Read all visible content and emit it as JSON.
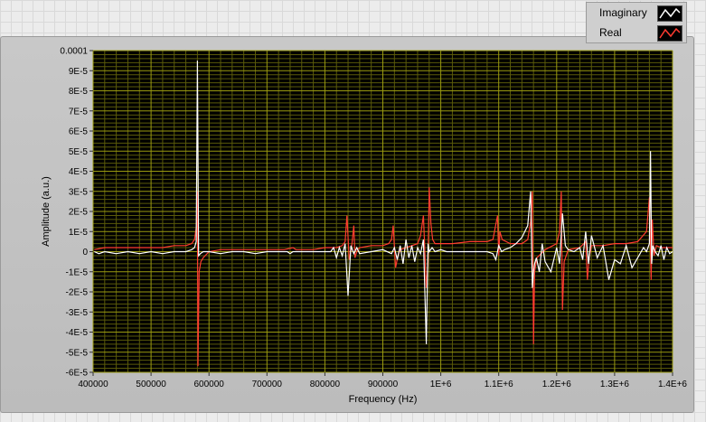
{
  "legend": {
    "items": [
      {
        "label": "Imaginary",
        "color": "#ffffff",
        "icon": "white-line-swatch"
      },
      {
        "label": "Real",
        "color": "#ff3b30",
        "icon": "red-line-swatch"
      }
    ]
  },
  "colors": {
    "plot_background": "#000000",
    "grid_major": "#9a9a10",
    "grid_minor": "#5a5a0a",
    "imaginary": "#ffffff",
    "real": "#ff3b30"
  },
  "chart_data": {
    "type": "line",
    "xlabel": "Frequency (Hz)",
    "ylabel": "Amplitude (a.u.)",
    "xlim": [
      400000,
      1400000
    ],
    "ylim": [
      -6e-05,
      0.0001
    ],
    "x_ticks": [
      400000,
      500000,
      600000,
      700000,
      800000,
      900000,
      1000000,
      1100000,
      1200000,
      1300000,
      1400000
    ],
    "x_tick_labels": [
      "400000",
      "500000",
      "600000",
      "700000",
      "800000",
      "900000",
      "1E+6",
      "1.1E+6",
      "1.2E+6",
      "1.3E+6",
      "1.4E+6"
    ],
    "y_ticks": [
      -6e-05,
      -5e-05,
      -4e-05,
      -3e-05,
      -2e-05,
      -1e-05,
      0,
      1e-05,
      2e-05,
      3e-05,
      4e-05,
      5e-05,
      6e-05,
      7e-05,
      8e-05,
      9e-05,
      0.0001
    ],
    "y_tick_labels": [
      "-6E-5",
      "-5E-5",
      "-4E-5",
      "-3E-5",
      "-2E-5",
      "-1E-5",
      "0",
      "1E-5",
      "2E-5",
      "3E-5",
      "4E-5",
      "5E-5",
      "6E-5",
      "7E-5",
      "8E-5",
      "9E-5",
      "0.0001"
    ],
    "grid": true,
    "legend_position": "top-right",
    "series": [
      {
        "name": "Imaginary",
        "color": "#ffffff",
        "x": [
          402000,
          410000,
          420000,
          440000,
          460000,
          480000,
          500000,
          520000,
          540000,
          560000,
          570000,
          575000,
          578000,
          580000,
          582000,
          585000,
          590000,
          600000,
          620000,
          640000,
          660000,
          680000,
          700000,
          720000,
          735000,
          740000,
          745000,
          750000,
          770000,
          790000,
          800000,
          810000,
          815000,
          820000,
          825000,
          830000,
          835000,
          840000,
          845000,
          850000,
          855000,
          860000,
          880000,
          900000,
          915000,
          920000,
          925000,
          930000,
          935000,
          940000,
          945000,
          950000,
          955000,
          960000,
          965000,
          970000,
          975000,
          978000,
          980000,
          985000,
          990000,
          1000000,
          1010000,
          1020000,
          1040000,
          1060000,
          1080000,
          1090000,
          1095000,
          1100000,
          1105000,
          1110000,
          1120000,
          1130000,
          1140000,
          1150000,
          1155000,
          1158000,
          1160000,
          1162000,
          1165000,
          1170000,
          1175000,
          1180000,
          1190000,
          1200000,
          1205000,
          1210000,
          1215000,
          1220000,
          1230000,
          1240000,
          1245000,
          1250000,
          1255000,
          1260000,
          1270000,
          1280000,
          1290000,
          1300000,
          1310000,
          1320000,
          1330000,
          1340000,
          1350000,
          1355000,
          1360000,
          1362000,
          1364000,
          1366000,
          1370000,
          1375000,
          1380000,
          1385000,
          1390000,
          1395000,
          1400000
        ],
        "y": [
          0,
          -1e-06,
          0,
          -1e-06,
          0,
          -1e-06,
          0,
          -1e-06,
          0,
          0,
          1e-06,
          2e-06,
          5e-06,
          9.5e-05,
          -2e-06,
          -1e-06,
          0,
          0,
          -1e-06,
          0,
          0,
          -1e-06,
          0,
          0,
          0,
          -1e-06,
          0,
          0,
          0,
          0,
          0,
          0,
          2e-06,
          -3e-06,
          2e-06,
          -2e-06,
          4e-06,
          -2.2e-05,
          3e-06,
          -1e-06,
          2e-06,
          -1e-06,
          0,
          1e-06,
          -1e-06,
          2e-06,
          -4e-06,
          3e-06,
          -6e-06,
          6e-06,
          -3e-06,
          3e-06,
          -5e-06,
          2e-06,
          -1e-06,
          6e-06,
          -4.6e-05,
          4e-06,
          0,
          2e-06,
          0,
          1e-06,
          0,
          0,
          0,
          0,
          0,
          -1e-06,
          -4e-06,
          3e-06,
          0,
          1e-06,
          2e-06,
          4e-06,
          7e-06,
          1.3e-05,
          3e-05,
          -1.8e-05,
          -1e-05,
          -6e-06,
          -3e-06,
          -1e-05,
          4e-06,
          -5e-06,
          -1e-05,
          2e-06,
          -6e-06,
          1.9e-05,
          3e-06,
          1e-06,
          0,
          2e-06,
          -4e-06,
          1e-05,
          -6e-06,
          8e-06,
          -3e-06,
          3e-06,
          -1.4e-05,
          -4e-06,
          -6e-06,
          3e-06,
          -8e-06,
          -3e-06,
          2e-06,
          0,
          4e-06,
          5e-05,
          -6e-06,
          3e-06,
          0,
          -2e-06,
          3e-06,
          -4e-06,
          2e-06,
          -1e-06,
          0
        ]
      },
      {
        "name": "Real",
        "color": "#ff3b30",
        "x": [
          402000,
          420000,
          440000,
          460000,
          480000,
          500000,
          520000,
          540000,
          560000,
          570000,
          575000,
          578000,
          580000,
          581000,
          583000,
          586000,
          590000,
          600000,
          620000,
          650000,
          700000,
          730000,
          745000,
          750000,
          780000,
          800000,
          820000,
          830000,
          835000,
          838000,
          842000,
          846000,
          850000,
          852000,
          856000,
          860000,
          880000,
          900000,
          910000,
          915000,
          918000,
          922000,
          926000,
          930000,
          940000,
          950000,
          960000,
          965000,
          970000,
          975000,
          978000,
          980000,
          983000,
          986000,
          990000,
          1000000,
          1020000,
          1050000,
          1080000,
          1090000,
          1098000,
          1100000,
          1102000,
          1106000,
          1120000,
          1140000,
          1150000,
          1155000,
          1158000,
          1160000,
          1162000,
          1166000,
          1180000,
          1200000,
          1205000,
          1208000,
          1210000,
          1213000,
          1220000,
          1240000,
          1250000,
          1253000,
          1256000,
          1260000,
          1280000,
          1300000,
          1320000,
          1340000,
          1355000,
          1360000,
          1363000,
          1365000,
          1368000,
          1372000,
          1380000,
          1390000,
          1400000
        ],
        "y": [
          1e-06,
          2e-06,
          2e-06,
          2e-06,
          2e-06,
          2e-06,
          2e-06,
          3e-06,
          3e-06,
          4e-06,
          6e-06,
          1.2e-05,
          3e-05,
          -5.7e-05,
          -1e-05,
          -5e-06,
          -3e-06,
          0,
          1e-06,
          1e-06,
          1e-06,
          1e-06,
          2e-06,
          1e-06,
          1e-06,
          2e-06,
          2e-06,
          3e-06,
          5e-06,
          1.8e-05,
          -4e-06,
          2e-06,
          1.3e-05,
          -3e-06,
          1e-06,
          2e-06,
          3e-06,
          3e-06,
          4e-06,
          6e-06,
          1.3e-05,
          -8e-06,
          -2e-06,
          1e-06,
          2e-06,
          3e-06,
          4e-06,
          8e-06,
          1.8e-05,
          -1.8e-05,
          -5e-06,
          3.2e-05,
          1.4e-05,
          6e-06,
          4e-06,
          4e-06,
          4e-06,
          5e-06,
          5e-06,
          6e-06,
          1.8e-05,
          -2e-06,
          1e-05,
          6e-06,
          4e-06,
          4e-06,
          6e-06,
          1.5e-05,
          3e-05,
          -4.6e-05,
          -1e-05,
          -3e-06,
          1e-06,
          4e-06,
          1e-05,
          3e-05,
          -2.9e-05,
          -5e-06,
          1e-06,
          2e-06,
          5e-06,
          -1.4e-05,
          -3e-06,
          3e-06,
          3e-06,
          4e-06,
          4e-06,
          5e-06,
          1e-05,
          2.7e-05,
          -1.4e-05,
          1.6e-05,
          -2e-06,
          3e-06,
          2e-06,
          2e-06,
          2e-06
        ]
      }
    ]
  }
}
